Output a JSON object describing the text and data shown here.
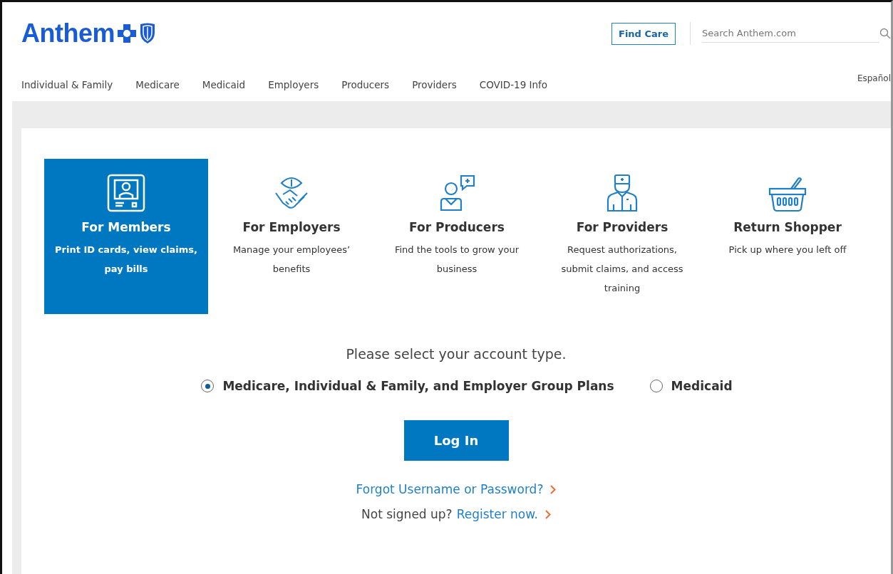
{
  "header": {
    "logo": "Anthem",
    "find_care": "Find Care",
    "search": {
      "placeholder": "Search Anthem.com"
    },
    "language": "Español"
  },
  "nav": [
    {
      "label": "Individual & Family"
    },
    {
      "label": "Medicare"
    },
    {
      "label": "Medicaid"
    },
    {
      "label": "Employers"
    },
    {
      "label": "Producers"
    },
    {
      "label": "Providers"
    },
    {
      "label": "COVID-19 Info"
    }
  ],
  "audiences": [
    {
      "title": "For Members",
      "text": "Print ID cards, view claims, pay bills",
      "selected": true
    },
    {
      "title": "For Employers",
      "text": "Manage your employees’ benefits",
      "selected": false
    },
    {
      "title": "For Producers",
      "text": "Find the tools to grow your business",
      "selected": false
    },
    {
      "title": "For Providers",
      "text": "Request authorizations, submit claims, and access training",
      "selected": false
    },
    {
      "title": "Return Shopper",
      "text": "Pick up where you left off",
      "selected": false
    }
  ],
  "prompt": "Please select your account type.",
  "account_types": [
    {
      "label": "Medicare, Individual & Family, and Employer Group Plans",
      "selected": true
    },
    {
      "label": "Medicaid",
      "selected": false
    }
  ],
  "login_button": "Log In",
  "forgot_link": "Forgot Username or Password?",
  "signup": {
    "text": "Not signed up?",
    "link": "Register now."
  }
}
